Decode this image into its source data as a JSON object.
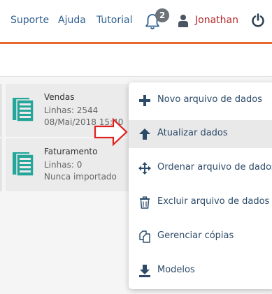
{
  "nav": {
    "links": [
      "Suporte",
      "Ajuda",
      "Tutorial"
    ],
    "notification_count": "2",
    "user_name": "Jonathan",
    "icons": {
      "bell": "bell-icon",
      "user": "user-icon",
      "power": "power-icon"
    }
  },
  "cards": [
    {
      "title": "Vendas",
      "rows_text": "Linhas: 2544",
      "status_text": "08/Mai/2018 15:40"
    },
    {
      "title": "Faturamento",
      "rows_text": "Linhas: 0",
      "status_text": "Nunca importado"
    }
  ],
  "menu": {
    "items": [
      {
        "label": "Novo arquivo de dados",
        "icon": "plus-icon"
      },
      {
        "label": "Atualizar dados",
        "icon": "arrow-up-icon"
      },
      {
        "label": "Ordenar arquivo de dados",
        "icon": "move-arrows-icon"
      },
      {
        "label": "Excluir arquivo de dados",
        "icon": "trash-icon"
      },
      {
        "label": "Gerenciar cópias",
        "icon": "copy-icon"
      },
      {
        "label": "Modelos",
        "icon": "download-icon"
      }
    ],
    "highlighted_item": "Atualizar dados"
  },
  "colors": {
    "accent_orange": "#e8692e",
    "nav_link": "#2f5f8f",
    "user_name": "#b52a2a",
    "dataset_icon": "#26a69a",
    "annotation_arrow": "#e02020",
    "menu_text": "#2c4a69"
  }
}
